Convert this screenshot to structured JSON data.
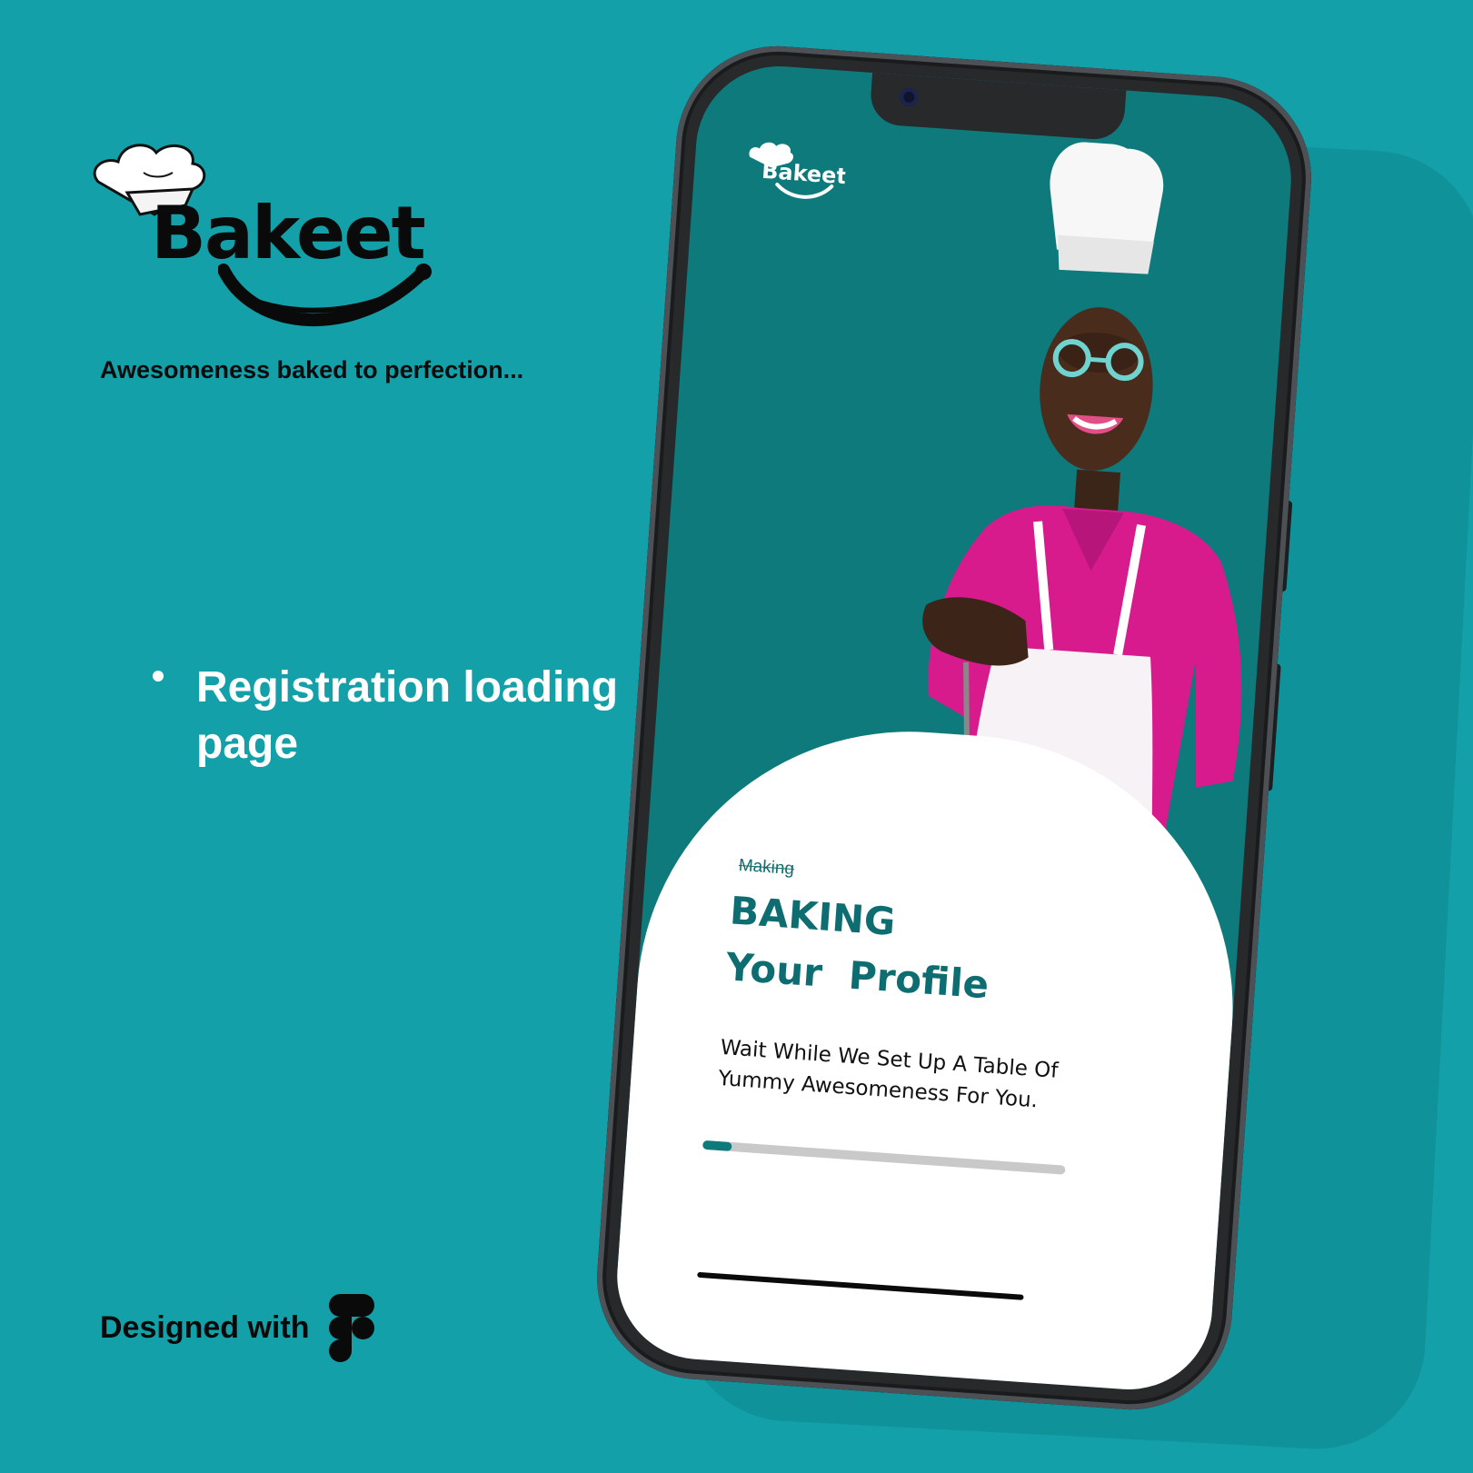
{
  "brand": {
    "name": "Bakeet",
    "tagline": "Awesomeness baked to perfection..."
  },
  "feature": {
    "title": "Registration loading page"
  },
  "footer": {
    "designed_with": "Designed with",
    "tool_icon": "figma-icon"
  },
  "phone": {
    "app_name": "Bakeet",
    "struck_word": "Making",
    "title_line1": "BAKING",
    "title_line2": "Your  Profile",
    "subtitle": "Wait While We Set Up A Table Of Yummy Awesomeness For You.",
    "progress": 0.08
  },
  "colors": {
    "background": "#13a0a8",
    "screen_bg": "#0e7a7c",
    "accent": "#0e6d70",
    "shirt": "#d81b8c",
    "bowl": "#29a7c6"
  }
}
